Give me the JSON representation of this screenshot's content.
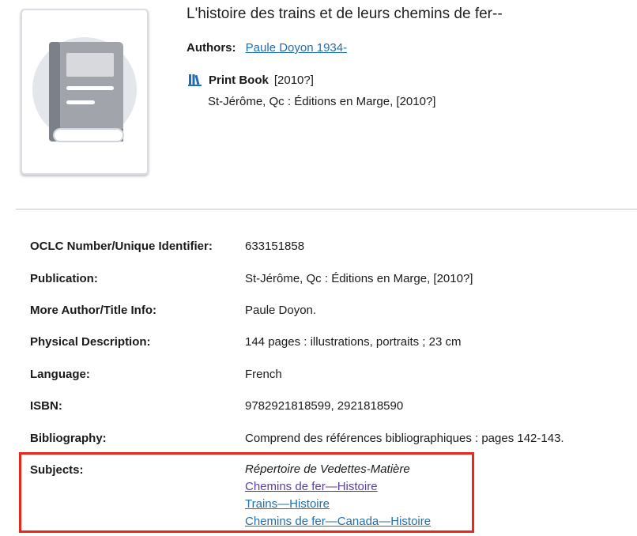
{
  "record": {
    "title": "L'histoire des trains et de leurs chemins de fer--",
    "authors_label": "Authors:",
    "author": "Paule Doyon 1934-",
    "format_icon": "book-stack-icon",
    "format": "Print Book",
    "date": "[2010?]",
    "publication_line": "St-Jérôme, Qc : Éditions en Marge, [2010?]",
    "cover_icon": "book-icon"
  },
  "details": {
    "oclc": {
      "label": "OCLC Number/Unique Identifier:",
      "value": "633151858"
    },
    "publication": {
      "label": "Publication:",
      "value": "St-Jérôme, Qc : Éditions en Marge, [2010?]"
    },
    "more_info": {
      "label": "More Author/Title Info:",
      "value": "Paule Doyon."
    },
    "physical": {
      "label": "Physical Description:",
      "value": "144 pages : illustrations, portraits ; 23 cm"
    },
    "language": {
      "label": "Language:",
      "value": "French"
    },
    "isbn": {
      "label": "ISBN:",
      "value": "9782921818599, 2921818590"
    },
    "bibliography": {
      "label": "Bibliography:",
      "value": "Comprend des références bibliographiques : pages 142-143."
    },
    "subjects": {
      "label": "Subjects:",
      "heading": "Répertoire de Vedettes-Matière",
      "items": [
        "Chemins de fer—Histoire",
        "Trains—Histoire",
        "Chemins de fer—Canada—Histoire"
      ]
    }
  },
  "colors": {
    "link": "#1f6fb2",
    "visited_link": "#5a3fa0",
    "highlight": "#e8281c"
  }
}
